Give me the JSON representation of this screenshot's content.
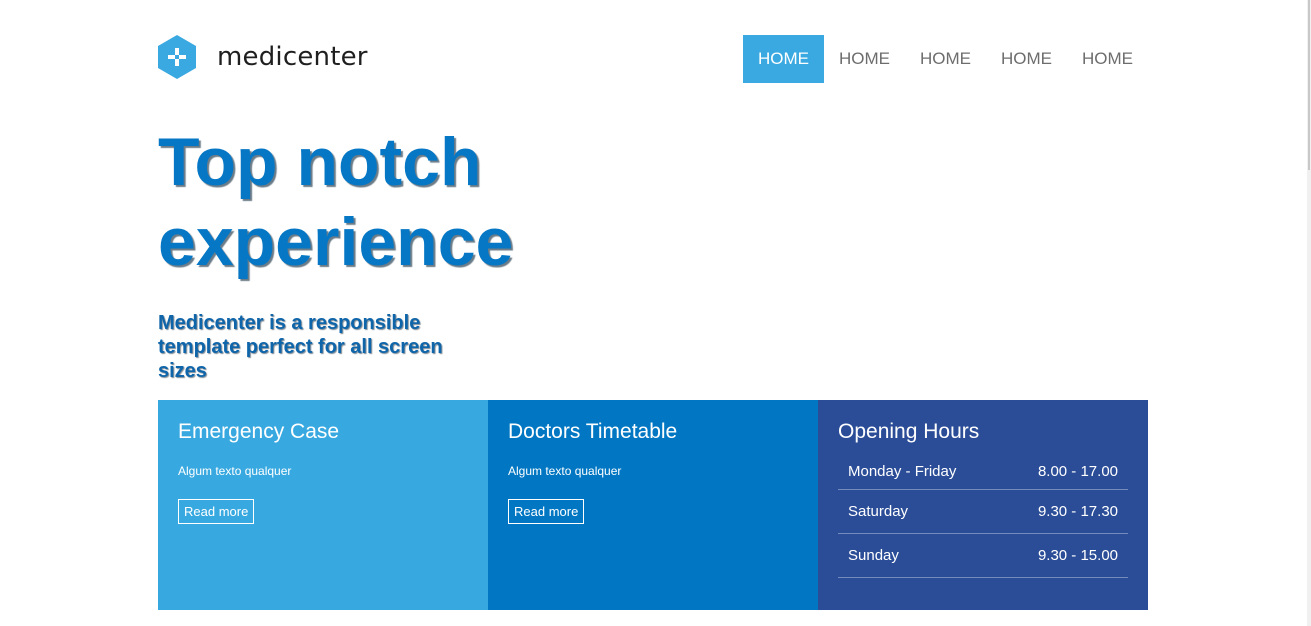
{
  "brand": {
    "name": "medicenter",
    "icon": "plus-hexagon-icon",
    "color": "#3aa9e1"
  },
  "nav": {
    "items": [
      {
        "label": "HOME",
        "active": true
      },
      {
        "label": "HOME",
        "active": false
      },
      {
        "label": "HOME",
        "active": false
      },
      {
        "label": "HOME",
        "active": false
      },
      {
        "label": "HOME",
        "active": false
      }
    ]
  },
  "hero": {
    "title_line1": "Top notch",
    "title_line2": "experience",
    "subtitle": "Medicenter is a responsible template perfect for all screen sizes"
  },
  "boxes": [
    {
      "title": "Emergency Case",
      "text": "Algum texto qualquer",
      "button": "Read more",
      "color": "#38a9e0"
    },
    {
      "title": "Doctors Timetable",
      "text": "Algum texto qualquer",
      "button": "Read more",
      "color": "#0177c3"
    },
    {
      "title": "Opening Hours",
      "color": "#2b4d97",
      "hours": [
        {
          "day": "Monday - Friday",
          "time": "8.00 - 17.00"
        },
        {
          "day": "Saturday",
          "time": "9.30 - 17.30"
        },
        {
          "day": "Sunday",
          "time": "9.30 - 15.00"
        }
      ]
    }
  ]
}
